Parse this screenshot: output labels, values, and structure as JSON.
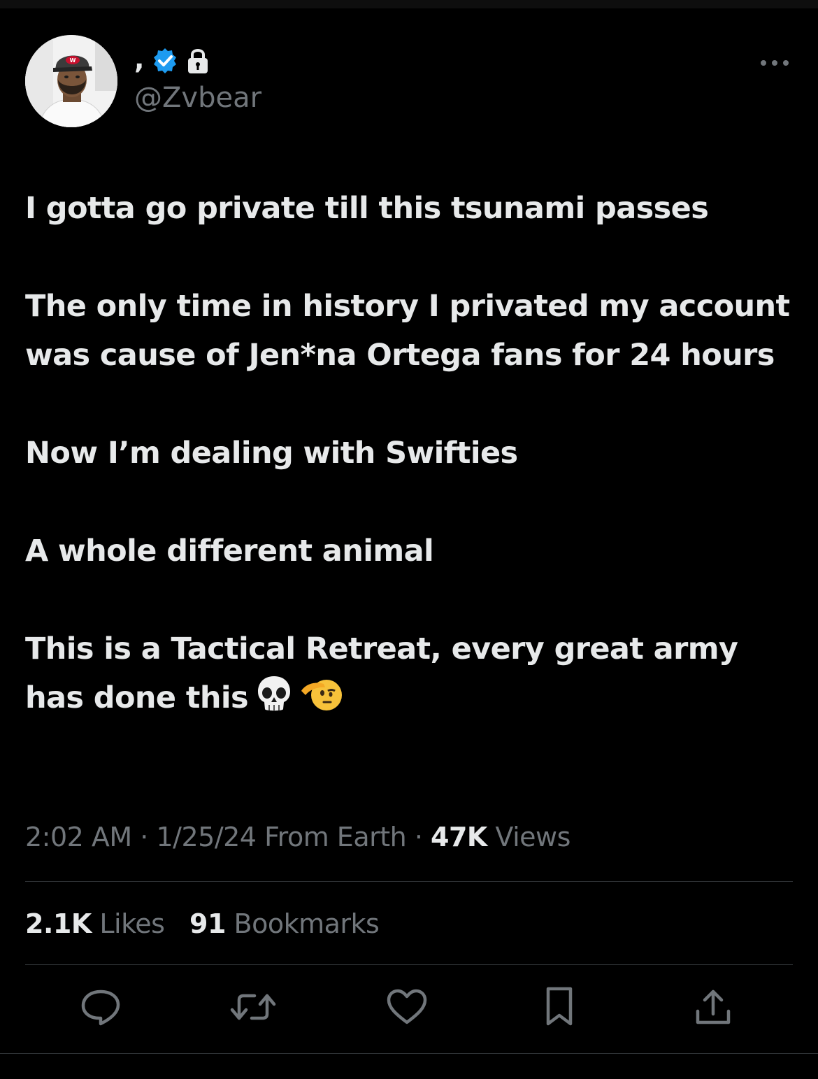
{
  "author": {
    "display_name": ",",
    "handle": "@Zvbear",
    "verified_badge_icon": "verified-badge-icon",
    "lock_icon": "lock-icon",
    "avatar_cap_text": "W"
  },
  "tweet": {
    "paragraphs": [
      "I gotta go private till this tsunami passes",
      "The only time in history I privated my account was cause of Jen*na Ortega fans for 24 hours",
      "Now I’m dealing with Swifties",
      "A whole different animal",
      "This is a Tactical Retreat, every great army has done this"
    ],
    "trailing_emojis": [
      "skull",
      "saluting-face"
    ]
  },
  "meta": {
    "time": "2:02 AM",
    "separator": "·",
    "date": "1/25/24",
    "location": "From Earth",
    "views_count": "47K",
    "views_label": "Views"
  },
  "stats": {
    "likes_count": "2.1K",
    "likes_label": "Likes",
    "bookmarks_count": "91",
    "bookmarks_label": "Bookmarks"
  },
  "actions": [
    "reply-icon",
    "retweet-icon",
    "like-icon",
    "bookmark-icon",
    "share-icon"
  ],
  "colors": {
    "background": "#000000",
    "text_primary": "#e7e9ea",
    "text_secondary": "#71767b",
    "divider": "#2f3336",
    "verified_blue": "#1d9bf0"
  }
}
